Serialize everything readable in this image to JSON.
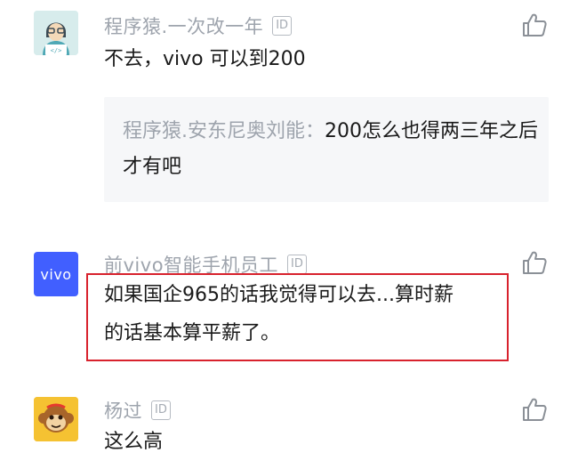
{
  "comments": [
    {
      "username": "程序猿.一次改一年",
      "id_badge": "ID",
      "content": "不去，vivo 可以到200",
      "reply": {
        "name": "程序猿.安东尼奥刘能：",
        "text": "200怎么也得两三年之后才有吧"
      }
    },
    {
      "username": "前vivo智能手机员工",
      "id_badge": "ID",
      "avatar_text": "vivo",
      "content_line1": "如果国企965的话我觉得可以去...算时薪",
      "content_line2": "的话基本算平薪了。"
    },
    {
      "username": "杨过",
      "id_badge": "ID",
      "content": "这么高"
    }
  ],
  "colors": {
    "highlight": "#d8222d",
    "vivo_brand": "#415fff",
    "username_gray": "#9ea4ad"
  }
}
